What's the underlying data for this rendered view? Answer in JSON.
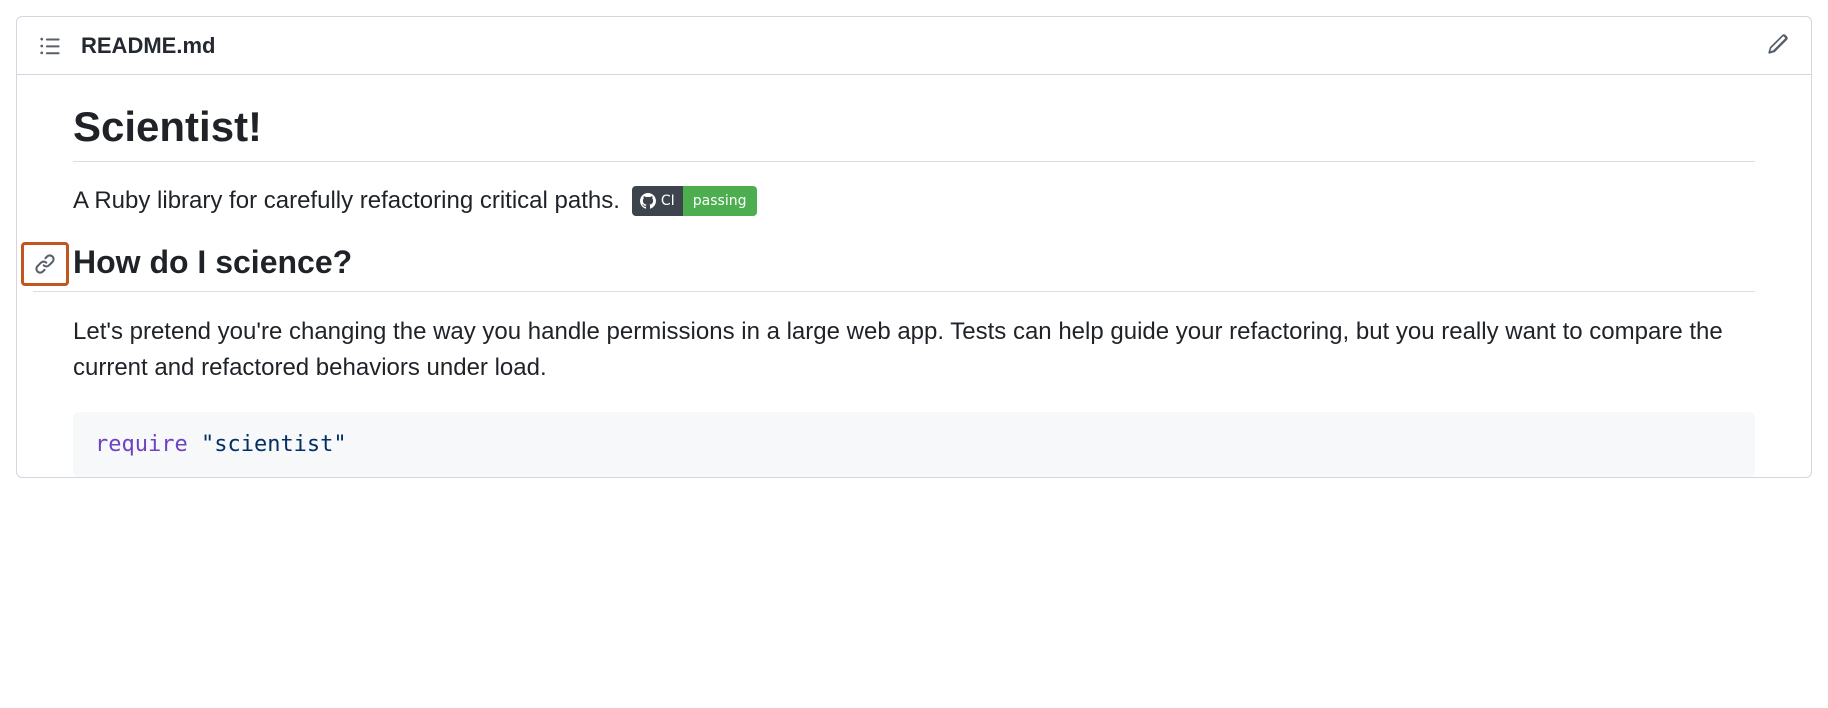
{
  "file": {
    "name": "README.md"
  },
  "content": {
    "title": "Scientist!",
    "description": "A Ruby library for carefully refactoring critical paths.",
    "badge": {
      "label": "CI",
      "status": "passing",
      "provider_icon": "github-icon"
    },
    "section_heading": "How do I science?",
    "section_paragraph": "Let's pretend you're changing the way you handle permissions in a large web app. Tests can help guide your refactoring, but you really want to compare the current and refactored behaviors under load.",
    "code": {
      "keyword": "require",
      "string": "\"scientist\""
    }
  },
  "colors": {
    "highlight_border": "#c05621",
    "badge_left": "#3d444d",
    "badge_right": "#4cae4f"
  }
}
